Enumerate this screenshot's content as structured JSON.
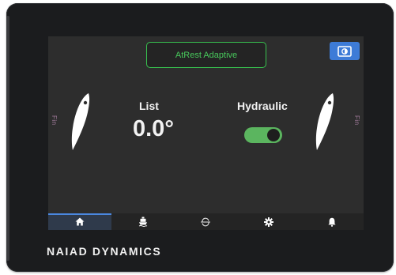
{
  "device": {
    "brand": "NAIAD DYNAMICS"
  },
  "header": {
    "mode_label": "AtRest Adaptive",
    "brightness_icon": "brightness-icon"
  },
  "fins": {
    "left_label": "Fin",
    "right_label": "Fin"
  },
  "list": {
    "label": "List",
    "value": "0.0°"
  },
  "hydraulic": {
    "label": "Hydraulic",
    "toggle_on": true
  },
  "navbar": {
    "items": [
      {
        "icon": "home-icon",
        "active": true
      },
      {
        "icon": "ship-icon",
        "active": false
      },
      {
        "icon": "sync-icon",
        "active": false
      },
      {
        "icon": "gear-icon",
        "active": false
      },
      {
        "icon": "bell-icon",
        "active": false
      }
    ]
  },
  "colors": {
    "accent_green": "#48c95c",
    "toggle_green": "#5bb55f",
    "accent_blue": "#3d7bd7",
    "screen_bg": "#2d2d2d"
  }
}
